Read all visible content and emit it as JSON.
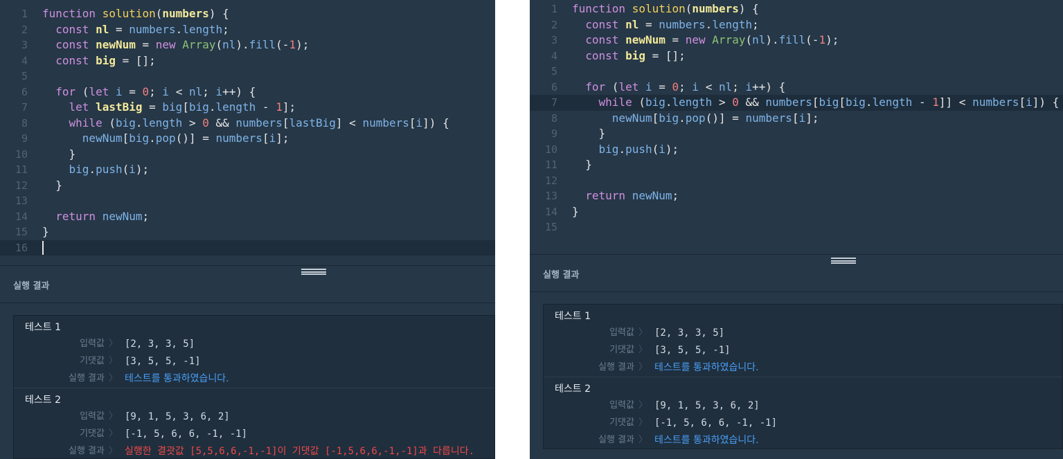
{
  "left": {
    "code_lines": [
      [
        [
          "k",
          "function "
        ],
        [
          "f",
          "solution"
        ],
        [
          "p",
          "("
        ],
        [
          "c",
          "numbers"
        ],
        [
          "p",
          ") {"
        ]
      ],
      [
        [
          "p",
          "  "
        ],
        [
          "k",
          "const "
        ],
        [
          "c",
          "nl"
        ],
        [
          "o",
          " = "
        ],
        [
          "v",
          "numbers"
        ],
        [
          "p",
          "."
        ],
        [
          "v",
          "length"
        ],
        [
          "p",
          ";"
        ]
      ],
      [
        [
          "p",
          "  "
        ],
        [
          "k",
          "const "
        ],
        [
          "c",
          "newNum"
        ],
        [
          "o",
          " = "
        ],
        [
          "k",
          "new "
        ],
        [
          "cl",
          "Array"
        ],
        [
          "p",
          "("
        ],
        [
          "v",
          "nl"
        ],
        [
          "p",
          ")."
        ],
        [
          "v",
          "fill"
        ],
        [
          "p",
          "(-"
        ],
        [
          "n",
          "1"
        ],
        [
          "p",
          ");"
        ]
      ],
      [
        [
          "p",
          "  "
        ],
        [
          "k",
          "const "
        ],
        [
          "c",
          "big"
        ],
        [
          "o",
          " = "
        ],
        [
          "p",
          "[];"
        ]
      ],
      [],
      [
        [
          "p",
          "  "
        ],
        [
          "k",
          "for "
        ],
        [
          "p",
          "("
        ],
        [
          "k",
          "let "
        ],
        [
          "v",
          "i"
        ],
        [
          "o",
          " = "
        ],
        [
          "n",
          "0"
        ],
        [
          "p",
          "; "
        ],
        [
          "v",
          "i"
        ],
        [
          "o",
          " < "
        ],
        [
          "v",
          "nl"
        ],
        [
          "p",
          "; "
        ],
        [
          "v",
          "i"
        ],
        [
          "p",
          "++) {"
        ]
      ],
      [
        [
          "p",
          "    "
        ],
        [
          "k",
          "let "
        ],
        [
          "c",
          "lastBig"
        ],
        [
          "o",
          " = "
        ],
        [
          "v",
          "big"
        ],
        [
          "p",
          "["
        ],
        [
          "v",
          "big"
        ],
        [
          "p",
          "."
        ],
        [
          "v",
          "length"
        ],
        [
          "o",
          " - "
        ],
        [
          "n",
          "1"
        ],
        [
          "p",
          "];"
        ]
      ],
      [
        [
          "p",
          "    "
        ],
        [
          "k",
          "while "
        ],
        [
          "p",
          "("
        ],
        [
          "v",
          "big"
        ],
        [
          "p",
          "."
        ],
        [
          "v",
          "length"
        ],
        [
          "o",
          " > "
        ],
        [
          "n",
          "0"
        ],
        [
          "o",
          " && "
        ],
        [
          "v",
          "numbers"
        ],
        [
          "p",
          "["
        ],
        [
          "v",
          "lastBig"
        ],
        [
          "p",
          "]"
        ],
        [
          "o",
          " < "
        ],
        [
          "v",
          "numbers"
        ],
        [
          "p",
          "["
        ],
        [
          "v",
          "i"
        ],
        [
          "p",
          "]) {"
        ]
      ],
      [
        [
          "p",
          "      "
        ],
        [
          "v",
          "newNum"
        ],
        [
          "p",
          "["
        ],
        [
          "v",
          "big"
        ],
        [
          "p",
          "."
        ],
        [
          "v",
          "pop"
        ],
        [
          "p",
          "()]"
        ],
        [
          "o",
          " = "
        ],
        [
          "v",
          "numbers"
        ],
        [
          "p",
          "["
        ],
        [
          "v",
          "i"
        ],
        [
          "p",
          "];"
        ]
      ],
      [
        [
          "p",
          "    }"
        ]
      ],
      [
        [
          "p",
          "    "
        ],
        [
          "v",
          "big"
        ],
        [
          "p",
          "."
        ],
        [
          "v",
          "push"
        ],
        [
          "p",
          "("
        ],
        [
          "v",
          "i"
        ],
        [
          "p",
          ");"
        ]
      ],
      [
        [
          "p",
          "  }"
        ]
      ],
      [],
      [
        [
          "p",
          "  "
        ],
        [
          "k",
          "return "
        ],
        [
          "v",
          "newNum"
        ],
        [
          "p",
          ";"
        ]
      ],
      [
        [
          "p",
          "}"
        ]
      ],
      []
    ],
    "active_line": 16,
    "results_title": "실행 결과",
    "tests": [
      {
        "title": "테스트 1",
        "rows": [
          {
            "label": "입력값",
            "value": "[2, 3, 3, 5]",
            "kind": "normal"
          },
          {
            "label": "기댓값",
            "value": "[3, 5, 5, -1]",
            "kind": "normal"
          },
          {
            "label": "실행 결과",
            "value": "테스트를 통과하였습니다.",
            "kind": "pass"
          }
        ]
      },
      {
        "title": "테스트 2",
        "rows": [
          {
            "label": "입력값",
            "value": "[9, 1, 5, 3, 6, 2]",
            "kind": "normal"
          },
          {
            "label": "기댓값",
            "value": "[-1, 5, 6, 6, -1, -1]",
            "kind": "normal"
          },
          {
            "label": "실행 결과",
            "value": "실행한 결괏값 [5,5,6,6,-1,-1]이 기댓값 [-1,5,6,6,-1,-1]과 다릅니다.",
            "kind": "fail"
          }
        ]
      }
    ]
  },
  "right": {
    "code_lines": [
      [
        [
          "k",
          "function "
        ],
        [
          "f",
          "solution"
        ],
        [
          "p",
          "("
        ],
        [
          "c",
          "numbers"
        ],
        [
          "p",
          ") {"
        ]
      ],
      [
        [
          "p",
          "  "
        ],
        [
          "k",
          "const "
        ],
        [
          "c",
          "nl"
        ],
        [
          "o",
          " = "
        ],
        [
          "v",
          "numbers"
        ],
        [
          "p",
          "."
        ],
        [
          "v",
          "length"
        ],
        [
          "p",
          ";"
        ]
      ],
      [
        [
          "p",
          "  "
        ],
        [
          "k",
          "const "
        ],
        [
          "c",
          "newNum"
        ],
        [
          "o",
          " = "
        ],
        [
          "k",
          "new "
        ],
        [
          "cl",
          "Array"
        ],
        [
          "p",
          "("
        ],
        [
          "v",
          "nl"
        ],
        [
          "p",
          ")."
        ],
        [
          "v",
          "fill"
        ],
        [
          "p",
          "(-"
        ],
        [
          "n",
          "1"
        ],
        [
          "p",
          ");"
        ]
      ],
      [
        [
          "p",
          "  "
        ],
        [
          "k",
          "const "
        ],
        [
          "c",
          "big"
        ],
        [
          "o",
          " = "
        ],
        [
          "p",
          "[];"
        ]
      ],
      [],
      [
        [
          "p",
          "  "
        ],
        [
          "k",
          "for "
        ],
        [
          "p",
          "("
        ],
        [
          "k",
          "let "
        ],
        [
          "v",
          "i"
        ],
        [
          "o",
          " = "
        ],
        [
          "n",
          "0"
        ],
        [
          "p",
          "; "
        ],
        [
          "v",
          "i"
        ],
        [
          "o",
          " < "
        ],
        [
          "v",
          "nl"
        ],
        [
          "p",
          "; "
        ],
        [
          "v",
          "i"
        ],
        [
          "p",
          "++) {"
        ]
      ],
      [
        [
          "p",
          "    "
        ],
        [
          "k",
          "while "
        ],
        [
          "p",
          "("
        ],
        [
          "v",
          "big"
        ],
        [
          "p",
          "."
        ],
        [
          "v",
          "length"
        ],
        [
          "o",
          " > "
        ],
        [
          "n",
          "0"
        ],
        [
          "o",
          " && "
        ],
        [
          "v",
          "numbers"
        ],
        [
          "p",
          "["
        ],
        [
          "v",
          "big"
        ],
        [
          "p",
          "["
        ],
        [
          "v",
          "big"
        ],
        [
          "p",
          "."
        ],
        [
          "v",
          "length"
        ],
        [
          "o",
          " - "
        ],
        [
          "n",
          "1"
        ],
        [
          "p",
          "]]"
        ],
        [
          "o",
          " < "
        ],
        [
          "v",
          "numbers"
        ],
        [
          "p",
          "["
        ],
        [
          "v",
          "i"
        ],
        [
          "p",
          "]) {"
        ]
      ],
      [
        [
          "p",
          "      "
        ],
        [
          "v",
          "newNum"
        ],
        [
          "p",
          "["
        ],
        [
          "v",
          "big"
        ],
        [
          "p",
          "."
        ],
        [
          "v",
          "pop"
        ],
        [
          "p",
          "()]"
        ],
        [
          "o",
          " = "
        ],
        [
          "v",
          "numbers"
        ],
        [
          "p",
          "["
        ],
        [
          "v",
          "i"
        ],
        [
          "p",
          "];"
        ]
      ],
      [
        [
          "p",
          "    }"
        ]
      ],
      [
        [
          "p",
          "    "
        ],
        [
          "v",
          "big"
        ],
        [
          "p",
          "."
        ],
        [
          "v",
          "push"
        ],
        [
          "p",
          "("
        ],
        [
          "v",
          "i"
        ],
        [
          "p",
          ");"
        ]
      ],
      [
        [
          "p",
          "  }"
        ]
      ],
      [],
      [
        [
          "p",
          "  "
        ],
        [
          "k",
          "return "
        ],
        [
          "v",
          "newNum"
        ],
        [
          "p",
          ";"
        ]
      ],
      [
        [
          "p",
          "}"
        ]
      ],
      []
    ],
    "active_line": 7,
    "results_title": "실행 결과",
    "tests": [
      {
        "title": "테스트 1",
        "rows": [
          {
            "label": "입력값",
            "value": "[2, 3, 3, 5]",
            "kind": "normal"
          },
          {
            "label": "기댓값",
            "value": "[3, 5, 5, -1]",
            "kind": "normal"
          },
          {
            "label": "실행 결과",
            "value": "테스트를 통과하였습니다.",
            "kind": "pass"
          }
        ]
      },
      {
        "title": "테스트 2",
        "rows": [
          {
            "label": "입력값",
            "value": "[9, 1, 5, 3, 6, 2]",
            "kind": "normal"
          },
          {
            "label": "기댓값",
            "value": "[-1, 5, 6, 6, -1, -1]",
            "kind": "normal"
          },
          {
            "label": "실행 결과",
            "value": "테스트를 통과하였습니다.",
            "kind": "pass"
          }
        ]
      }
    ]
  }
}
